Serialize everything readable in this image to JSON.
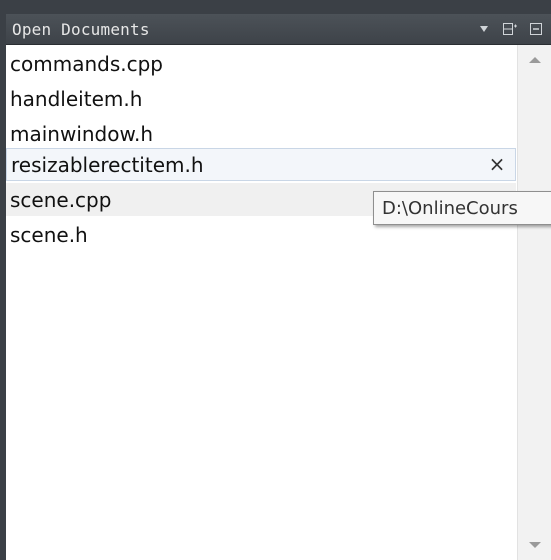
{
  "header": {
    "title": "Open Documents",
    "icons": [
      "dropdown-arrow-icon",
      "split-icon",
      "close-pane-icon"
    ]
  },
  "documents": [
    {
      "name": "commands.cpp"
    },
    {
      "name": "handleitem.h"
    },
    {
      "name": "mainwindow.h"
    },
    {
      "name": "resizablerectitem.h",
      "selected": true,
      "close_label": "×"
    },
    {
      "name": "scene.cpp",
      "hovered": true
    },
    {
      "name": "scene.h"
    }
  ],
  "tooltip": {
    "text": "D:\\OnlineCours"
  },
  "colors": {
    "header_bg": "#474d53",
    "list_bg": "#ffffff",
    "selected_bg": "#f3f6fa",
    "selected_border": "#c9d6e6"
  }
}
